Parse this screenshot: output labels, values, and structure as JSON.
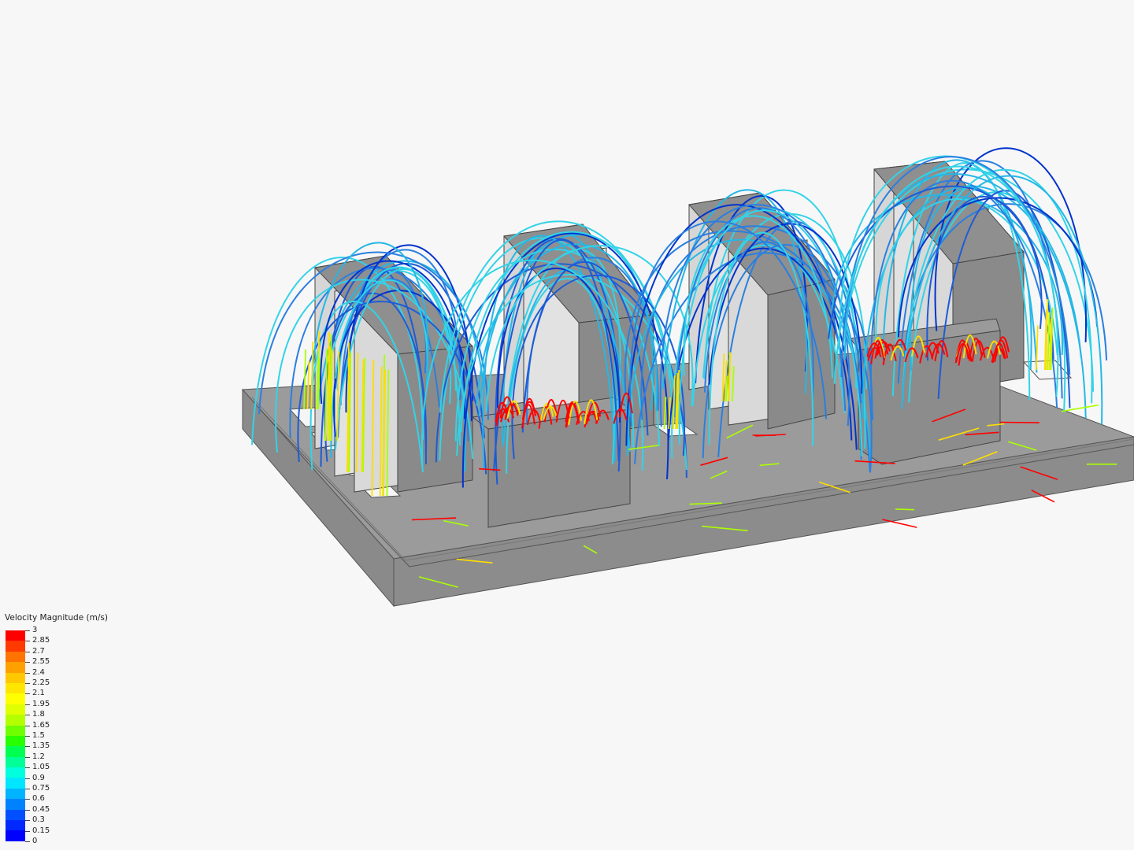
{
  "legend": {
    "title": "Velocity Magnitude (m/s)",
    "ticks": [
      "3",
      "2.85",
      "2.7",
      "2.55",
      "2.4",
      "2.25",
      "2.1",
      "1.95",
      "1.8",
      "1.65",
      "1.5",
      "1.35",
      "1.2",
      "1.05",
      "0.9",
      "0.75",
      "0.6",
      "0.45",
      "0.3",
      "0.15",
      "0"
    ],
    "colors": [
      "#ff0000",
      "#ff3a00",
      "#ff7300",
      "#ffa000",
      "#ffc800",
      "#ffe600",
      "#ffff00",
      "#e0ff00",
      "#b4ff00",
      "#6eff00",
      "#28ff00",
      "#00ff50",
      "#00ff96",
      "#00ffdc",
      "#00e6ff",
      "#00b4ff",
      "#0082ff",
      "#0050ff",
      "#0028ff",
      "#0000ff"
    ]
  },
  "scene": {
    "base_color": "#8c8c8c",
    "block_color": "#8f8f8f",
    "panel_color": "#dcdcdc",
    "streamline_palette": [
      "#1e5bd6",
      "#2a7fe0",
      "#24b7e6",
      "#32d3e8",
      "#0033cc",
      "#ffdd00",
      "#aaff00",
      "#ff0000"
    ]
  }
}
